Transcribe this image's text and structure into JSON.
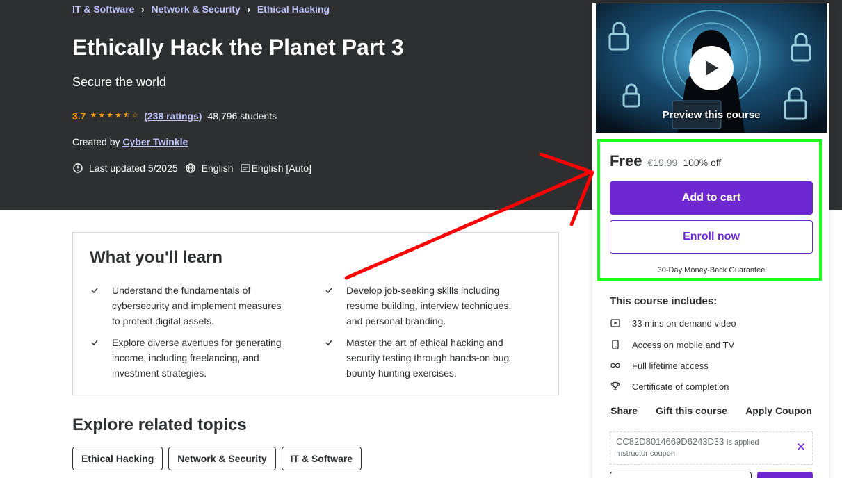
{
  "breadcrumb": [
    {
      "label": "IT & Software"
    },
    {
      "label": "Network & Security"
    },
    {
      "label": "Ethical Hacking"
    }
  ],
  "course": {
    "title": "Ethically Hack the Planet Part 3",
    "subtitle": "Secure the world",
    "rating": "3.7",
    "ratings_count": "(238 ratings)",
    "students": "48,796 students",
    "created_by_label": "Created by",
    "instructor": "Cyber Twinkle",
    "last_updated": "Last updated 5/2025",
    "language": "English",
    "captions": "English [Auto]"
  },
  "learn": {
    "title": "What you'll learn",
    "items": [
      "Understand the fundamentals of cybersecurity and implement measures to protect digital assets.",
      "Develop job-seeking skills including resume building, interview techniques, and personal branding.",
      "Explore diverse avenues for generating income, including freelancing, and investment strategies.",
      "Master the art of ethical hacking and security testing through hands-on bug bounty hunting exercises."
    ]
  },
  "explore": {
    "title": "Explore related topics",
    "topics": [
      "Ethical Hacking",
      "Network & Security",
      "IT & Software"
    ]
  },
  "sidebar": {
    "preview_label": "Preview this course",
    "price": "Free",
    "original_price": "€19.99",
    "discount": "100% off",
    "add_to_cart": "Add to cart",
    "enroll_now": "Enroll now",
    "guarantee": "30-Day Money-Back Guarantee",
    "includes_title": "This course includes:",
    "includes": [
      {
        "icon": "video-icon",
        "label": "33 mins on-demand video"
      },
      {
        "icon": "mobile-icon",
        "label": "Access on mobile and TV"
      },
      {
        "icon": "infinity-icon",
        "label": "Full lifetime access"
      },
      {
        "icon": "trophy-icon",
        "label": "Certificate of completion"
      }
    ],
    "share": "Share",
    "gift": "Gift this course",
    "apply_coupon": "Apply Coupon",
    "coupon_code": "CC82D8014669D6243D33",
    "coupon_applied": "is applied",
    "coupon_type": "Instructor coupon"
  },
  "colors": {
    "hero_bg": "#2d2f31",
    "accent_purple": "#6d28d2",
    "link_lavender": "#c0c4fc",
    "rating_orange": "#f69c08",
    "highlight_green": "#1fff1f",
    "annotation_red": "#ff0000"
  }
}
